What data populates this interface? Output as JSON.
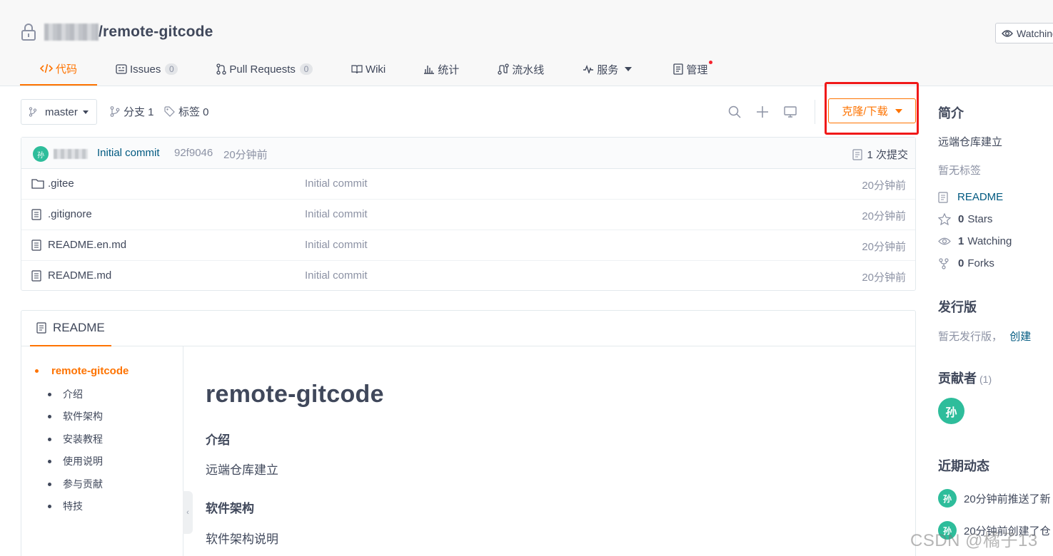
{
  "repo": {
    "name": "/remote-gitcode",
    "watch_label": "Watching"
  },
  "tabs": [
    {
      "label": "代码"
    },
    {
      "label": "Issues",
      "badge": "0"
    },
    {
      "label": "Pull Requests",
      "badge": "0"
    },
    {
      "label": "Wiki"
    },
    {
      "label": "统计"
    },
    {
      "label": "流水线"
    },
    {
      "label": "服务"
    },
    {
      "label": "管理"
    }
  ],
  "toolbar": {
    "branch": "master",
    "branches": "分支 1",
    "tags": "标签 0",
    "clone_label": "克隆/下载"
  },
  "commit": {
    "avatar_text": "孙",
    "message": "Initial commit",
    "sha": "92f9046",
    "time": "20分钟前",
    "count": "1 次提交"
  },
  "files": [
    {
      "name": ".gitee",
      "type": "folder",
      "commit": "Initial commit",
      "time": "20分钟前"
    },
    {
      "name": ".gitignore",
      "type": "file",
      "commit": "Initial commit",
      "time": "20分钟前"
    },
    {
      "name": "README.en.md",
      "type": "file",
      "commit": "Initial commit",
      "time": "20分钟前"
    },
    {
      "name": "README.md",
      "type": "file",
      "commit": "Initial commit",
      "time": "20分钟前"
    }
  ],
  "readme": {
    "tab_label": "README",
    "toc": [
      "remote-gitcode",
      "介绍",
      "软件架构",
      "安装教程",
      "使用说明",
      "参与贡献",
      "特技"
    ],
    "h1": "remote-gitcode",
    "sections": [
      {
        "heading": "介绍",
        "text": "远端仓库建立"
      },
      {
        "heading": "软件架构",
        "text": "软件架构说明"
      }
    ]
  },
  "sidebar": {
    "intro_title": "简介",
    "intro_text": "远端仓库建立",
    "no_tags": "暂无标签",
    "readme_link": "README",
    "stars_num": "0",
    "stars_label": "Stars",
    "watching_num": "1",
    "watching_label": "Watching",
    "forks_num": "0",
    "forks_label": "Forks",
    "release_title": "发行版",
    "release_text": "暂无发行版，",
    "release_create": "创建",
    "contrib_title": "贡献者",
    "contrib_count": "(1)",
    "contrib_avatar": "孙",
    "activity_title": "近期动态",
    "activities": [
      {
        "avatar": "孙",
        "text": "20分钟前推送了新"
      },
      {
        "avatar": "孙",
        "text": "20分钟前创建了仓"
      }
    ]
  },
  "watermark": "CSDN @橘子13",
  "colors": {
    "accent": "#fe7300",
    "link": "#005980",
    "highlight_box": "#f01919",
    "avatar": "#2ebd9b"
  }
}
